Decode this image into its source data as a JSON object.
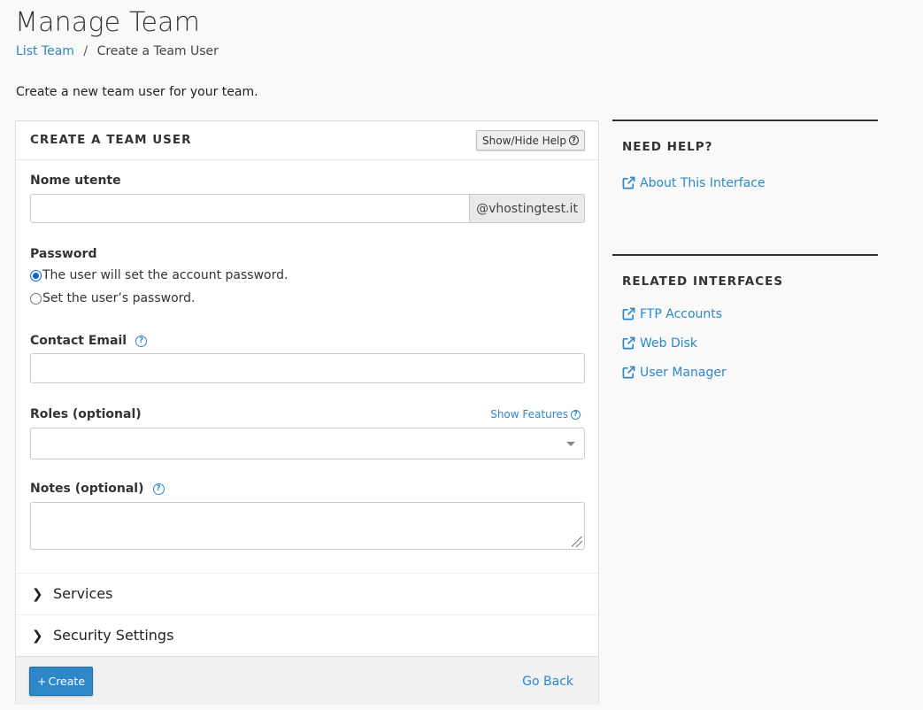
{
  "header": {
    "title": "Manage Team",
    "breadcrumb": {
      "link": "List Team",
      "separator": "/",
      "current": "Create a Team User"
    },
    "intro": "Create a new team user for your team."
  },
  "form": {
    "title": "CREATE A TEAM USER",
    "help_button": "Show/Hide Help",
    "username": {
      "label": "Nome utente",
      "value": "",
      "domain": "@vhostingtest.it"
    },
    "password": {
      "label": "Password",
      "options": [
        {
          "label": "The user will set the account password.",
          "checked": true
        },
        {
          "label": "Set the user’s password.",
          "checked": false
        }
      ]
    },
    "email": {
      "label": "Contact Email",
      "value": ""
    },
    "roles": {
      "label": "Roles (optional)",
      "show_features": "Show Features",
      "value": ""
    },
    "notes": {
      "label": "Notes (optional)",
      "value": ""
    },
    "sections": [
      {
        "label": "Services"
      },
      {
        "label": "Security Settings"
      }
    ],
    "create_button": "Create",
    "create_icon": "+",
    "go_back": "Go Back"
  },
  "sidebar": {
    "help": {
      "title": "NEED HELP?",
      "links": [
        "About This Interface"
      ]
    },
    "related": {
      "title": "RELATED INTERFACES",
      "links": [
        "FTP Accounts",
        "Web Disk",
        "User Manager"
      ]
    }
  },
  "colors": {
    "link": "#2d87c8",
    "primary_button": "#2d87c8"
  }
}
